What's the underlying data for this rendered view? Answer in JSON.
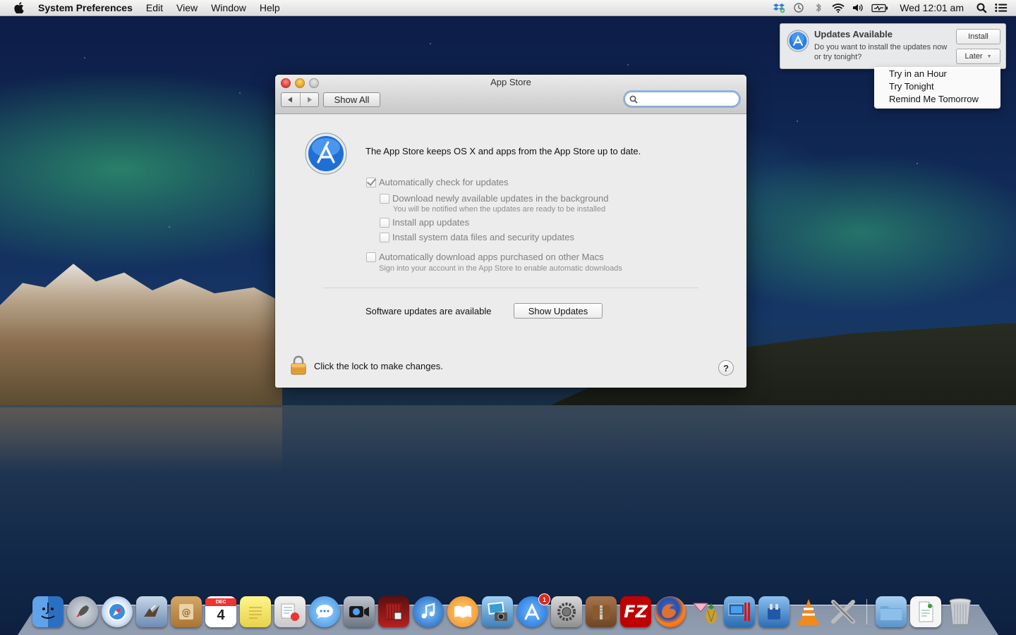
{
  "menubar": {
    "app_name": "System Preferences",
    "menus": [
      "Edit",
      "View",
      "Window",
      "Help"
    ],
    "clock": "Wed 12:01 am",
    "status_icons": [
      "dropbox-icon",
      "time-machine-icon",
      "bluetooth-icon",
      "wifi-icon",
      "volume-icon",
      "battery-icon",
      "spotlight-icon",
      "notification-center-icon"
    ]
  },
  "notification": {
    "title": "Updates Available",
    "body": "Do you want to install the updates now or try tonight?",
    "install_label": "Install",
    "later_label": "Later",
    "later_menu": [
      "Try in an Hour",
      "Try Tonight",
      "Remind Me Tomorrow"
    ]
  },
  "window": {
    "title": "App Store",
    "show_all_label": "Show All",
    "search_value": "",
    "description": "The App Store keeps OS X and apps from the App Store up to date.",
    "options": {
      "auto_check": {
        "label": "Automatically check for updates",
        "checked": true
      },
      "download_background": {
        "label": "Download newly available updates in the background",
        "note": "You will be notified when the updates are ready to be installed",
        "checked": false
      },
      "install_app_updates": {
        "label": "Install app updates",
        "checked": false
      },
      "install_system_data": {
        "label": "Install system data files and security updates",
        "checked": false
      },
      "auto_download_purchased": {
        "label": "Automatically download apps purchased on other Macs",
        "note": "Sign into your account in the App Store to enable automatic downloads",
        "checked": false
      }
    },
    "updates_label": "Software updates are available",
    "show_updates_label": "Show Updates",
    "lock_label": "Click the lock to make changes.",
    "help_label": "?"
  },
  "dock": {
    "calendar_month": "DEC",
    "calendar_day": "4",
    "app_store_badge": "1",
    "filezilla_label": "FZ"
  },
  "colors": {
    "accent_blue": "#2a7de1",
    "badge_red": "#e0261f"
  }
}
